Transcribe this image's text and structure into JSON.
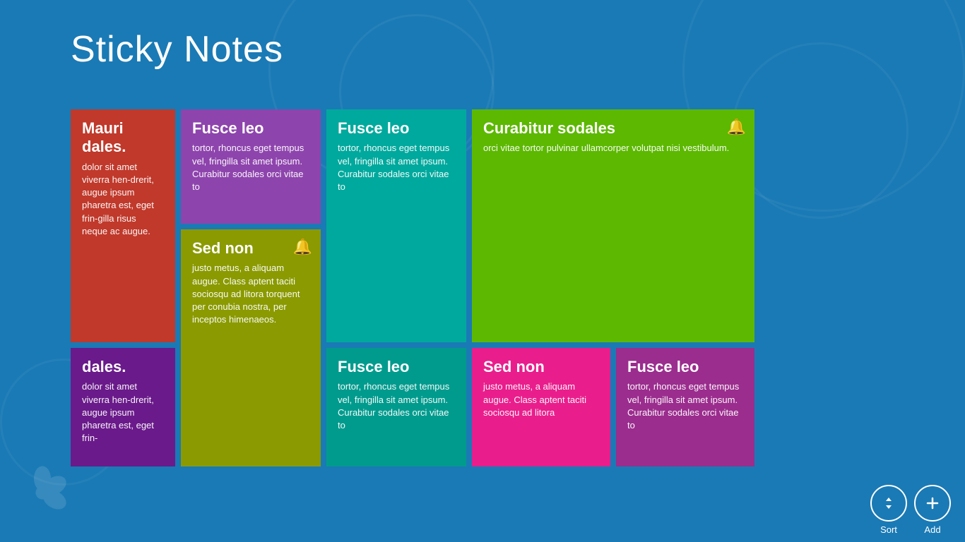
{
  "app": {
    "title": "Sticky Notes"
  },
  "notes": [
    {
      "id": "note1",
      "title": "Mauri dales.",
      "body": "dolor sit amet viverra hen-drerit, augue ipsum pharetra est, eget frin-gilla risus neque ac augue.",
      "color": "red",
      "has_bell": false,
      "col": 1,
      "size": "tall"
    },
    {
      "id": "note2",
      "title": "dales.",
      "body": "dolor sit amet viverra hen-drerit, augue ipsum pharetra est, eget frin-",
      "color": "purple-dark",
      "has_bell": false,
      "col": 1,
      "size": "medium"
    },
    {
      "id": "note3",
      "title": "Fusce leo",
      "body": "tortor, rhoncus eget tempus vel, fringilla sit amet ipsum. Curabitur sodales orci vitae to",
      "color": "purple",
      "has_bell": false,
      "col": 2,
      "size": "medium"
    },
    {
      "id": "note4",
      "title": "Sed non",
      "body": "justo metus, a aliquam augue. Class aptent taciti sociosqu ad litora torquent per conubia nostra, per inceptos himenaeos.",
      "color": "olive",
      "has_bell": true,
      "col": 2,
      "size": "large"
    },
    {
      "id": "note5",
      "title": "Fusce leo",
      "body": "tortor, rhoncus eget tempus vel, fringilla sit amet ipsum. Curabitur sodales orci vitae to",
      "color": "teal",
      "has_bell": false,
      "col": 3,
      "size": "tall"
    },
    {
      "id": "note6",
      "title": "Fusce leo",
      "body": "tortor, rhoncus eget tempus vel, fringilla sit amet ipsum. Curabitur sodales orci vitae to",
      "color": "teal-dark",
      "has_bell": false,
      "col": 3,
      "size": "medium"
    },
    {
      "id": "note7",
      "title": "Curabitur sodales",
      "body": "orci vitae tortor pulvinar ullamcorper volutpat nisi vestibulum.",
      "color": "green",
      "has_bell": true,
      "col": 4,
      "size": "wide-tall"
    },
    {
      "id": "note8",
      "title": "Sed non",
      "body": "justo metus, a aliquam augue. Class aptent taciti sociosqu ad litora",
      "color": "pink",
      "has_bell": false,
      "col": 4,
      "size": "medium"
    },
    {
      "id": "note9",
      "title": "Fusce leo",
      "body": "tortor, rhoncus eget tempus vel, fringilla sit amet ipsum. Curabitur sodales orci vitae to",
      "color": "magenta",
      "has_bell": false,
      "col": 4,
      "size": "medium"
    }
  ],
  "toolbar": {
    "sort_label": "Sort",
    "add_label": "Add",
    "sort_icon": "↕",
    "add_icon": "+"
  }
}
